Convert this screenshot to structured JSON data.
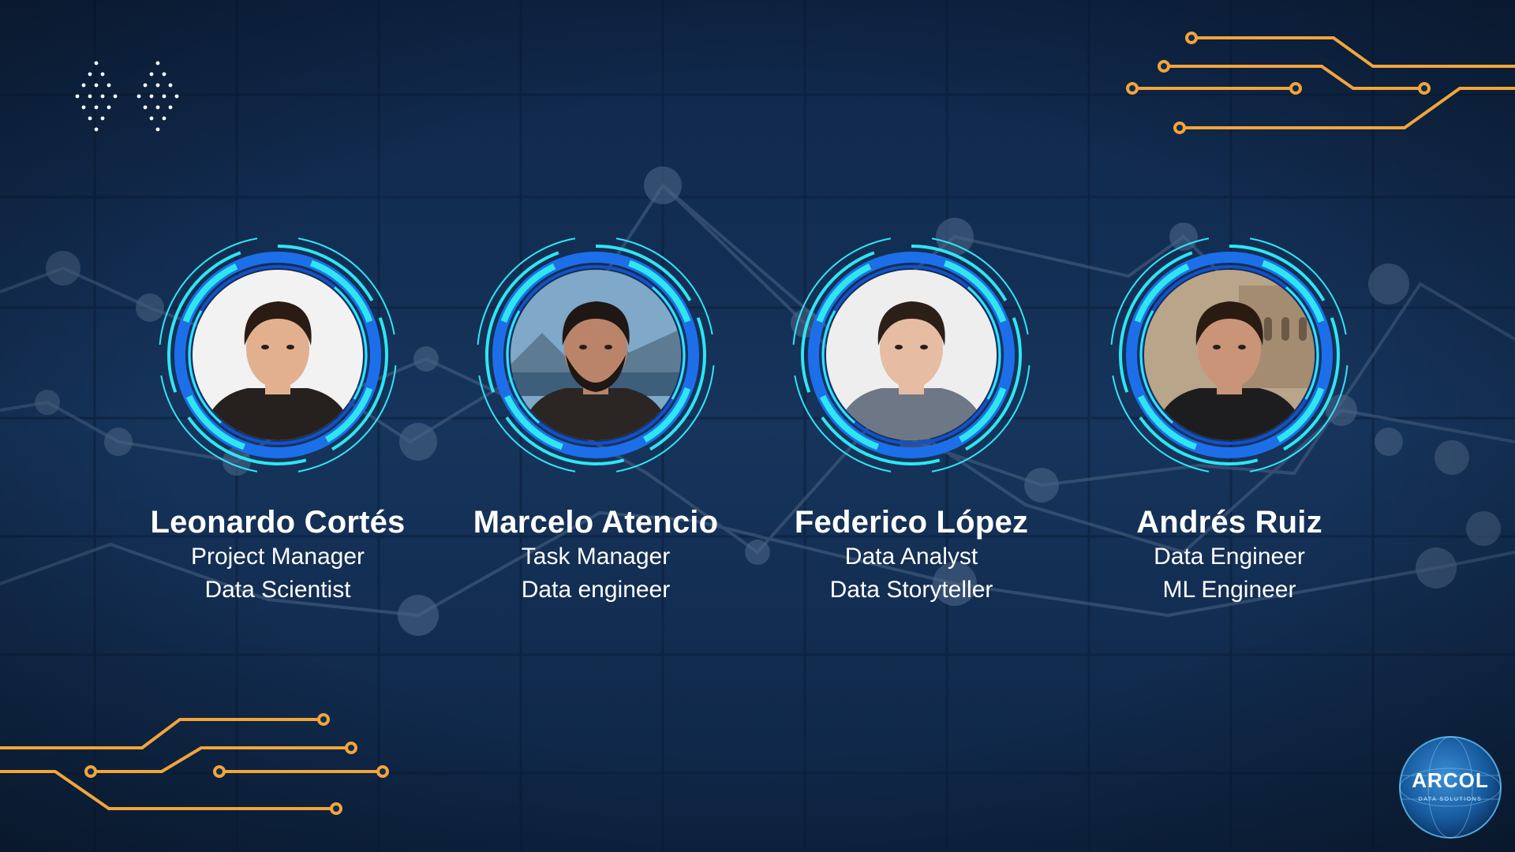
{
  "members": [
    {
      "name": "Leonardo Cortés",
      "role1": "Project Manager",
      "role2": "Data Scientist",
      "photo_bg": "#f2f2f2",
      "hair": "#2a1c14",
      "skin": "#e3b08f",
      "shirt": "#26211f"
    },
    {
      "name": "Marcelo Atencio",
      "role1": "Task Manager",
      "role2": "Data engineer",
      "photo_bg": "#7fa8c9",
      "hair": "#1e1714",
      "skin": "#b98469",
      "shirt": "#2b2623"
    },
    {
      "name": "Federico López",
      "role1": "Data Analyst",
      "role2": "Data Storyteller",
      "photo_bg": "#eeeeee",
      "hair": "#2b2018",
      "skin": "#e6bca2",
      "shirt": "#6d7785"
    },
    {
      "name": "Andrés Ruiz",
      "role1": "Data Engineer",
      "role2": "ML Engineer",
      "photo_bg": "#b9a58a",
      "hair": "#2a1b12",
      "skin": "#c99478",
      "shirt": "#1d1d1f"
    }
  ],
  "logo": {
    "text": "ARCOL",
    "subtitle": "DATA SOLUTIONS"
  },
  "colors": {
    "background": "#112b4d",
    "ring_cyan": "#2ee6f2",
    "ring_blue": "#1c6fe8",
    "circuit_orange": "#f2a53a",
    "text": "#ffffff"
  }
}
